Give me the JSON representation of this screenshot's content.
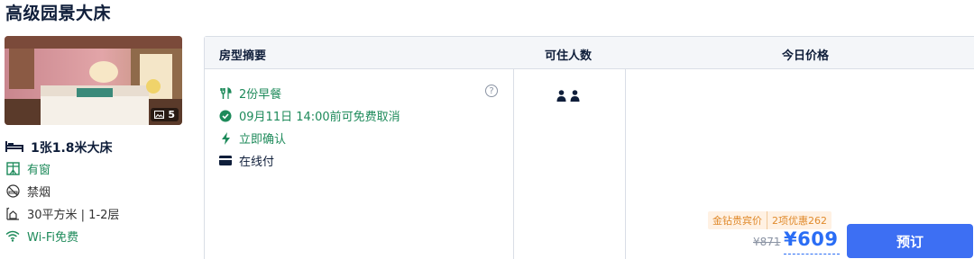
{
  "room": {
    "title": "高级园景大床",
    "photo_count": "5",
    "bed": "1张1.8米大床",
    "amenities": [
      {
        "icon": "window-icon",
        "label": "有窗",
        "color": "#1d8a5a"
      },
      {
        "icon": "no-smoking-icon",
        "label": "禁烟",
        "color": "#333333"
      },
      {
        "icon": "area-icon",
        "label": "30平方米 | 1-2层",
        "color": "#333333"
      },
      {
        "icon": "wifi-icon",
        "label": "Wi-Fi免费",
        "color": "#1d8a5a"
      }
    ]
  },
  "table": {
    "headers": [
      "房型摘要",
      "可住人数",
      "今日价格"
    ],
    "features": [
      {
        "icon": "utensils-icon",
        "label": "2份早餐"
      },
      {
        "icon": "check-circle-icon",
        "label": "09月11日 14:00前可免费取消"
      },
      {
        "icon": "lightning-icon",
        "label": "立即确认"
      },
      {
        "icon": "card-icon",
        "label": "在线付"
      }
    ],
    "help_glyph": "?",
    "guests_count": 2,
    "promo_tag": "金钻贵宾价",
    "promo_discount": "2项优惠262",
    "original_price": "¥871",
    "price": "¥609",
    "book_label": "预订"
  },
  "colors": {
    "green": "#1d8a5a",
    "price_blue": "#2a6df5",
    "button_blue": "#3d6ff3",
    "promo_orange": "#e08a2c",
    "header_bg": "#f4f6f9"
  }
}
